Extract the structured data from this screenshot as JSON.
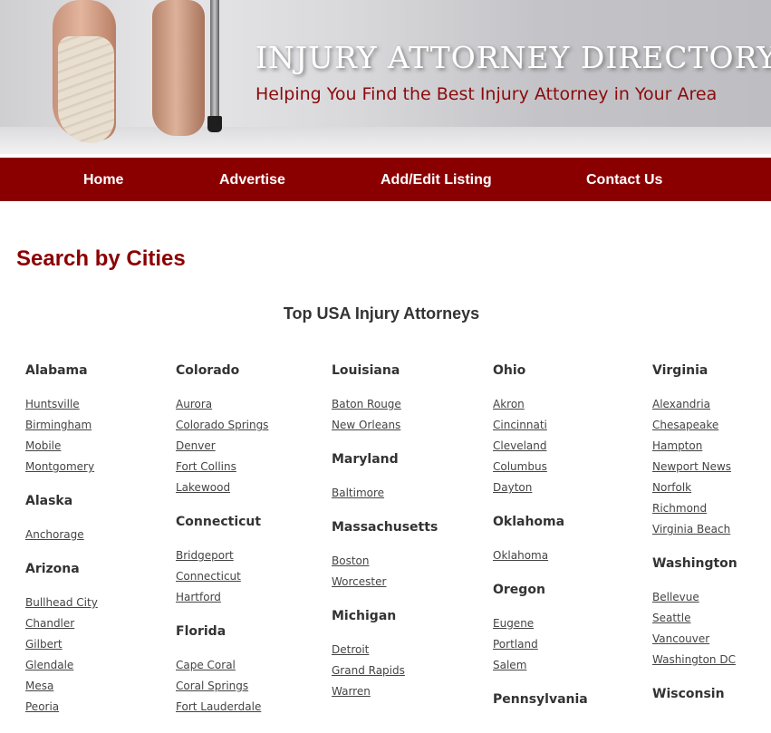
{
  "header": {
    "title": "INJURY ATTORNEY DIRECTORY",
    "tagline": "Helping You Find the Best Injury Attorney in Your Area"
  },
  "nav": {
    "items": [
      "Home",
      "Advertise",
      "Add/Edit Listing",
      "Contact Us"
    ]
  },
  "main": {
    "section_title": "Search by Cities",
    "heading": "Top USA Injury Attorneys"
  },
  "columns": [
    [
      {
        "state": "Alabama",
        "cities": [
          "Huntsville",
          "Birmingham",
          "Mobile",
          "Montgomery"
        ]
      },
      {
        "state": "Alaska",
        "cities": [
          "Anchorage"
        ]
      },
      {
        "state": "Arizona",
        "cities": [
          "Bullhead City",
          "Chandler",
          "Gilbert",
          "Glendale",
          "Mesa",
          "Peoria"
        ]
      }
    ],
    [
      {
        "state": "Colorado",
        "cities": [
          "Aurora",
          "Colorado Springs",
          "Denver",
          "Fort Collins",
          "Lakewood"
        ]
      },
      {
        "state": "Connecticut",
        "cities": [
          "Bridgeport",
          "Connecticut",
          "Hartford"
        ]
      },
      {
        "state": "Florida",
        "cities": [
          "Cape Coral",
          "Coral Springs",
          "Fort Lauderdale"
        ]
      }
    ],
    [
      {
        "state": "Louisiana",
        "cities": [
          "Baton Rouge",
          "New Orleans"
        ]
      },
      {
        "state": "Maryland",
        "cities": [
          "Baltimore"
        ]
      },
      {
        "state": "Massachusetts",
        "cities": [
          "Boston",
          "Worcester"
        ]
      },
      {
        "state": "Michigan",
        "cities": [
          "Detroit",
          "Grand Rapids",
          "Warren"
        ]
      }
    ],
    [
      {
        "state": "Ohio",
        "cities": [
          "Akron",
          "Cincinnati",
          "Cleveland",
          "Columbus",
          "Dayton"
        ]
      },
      {
        "state": "Oklahoma",
        "cities": [
          "Oklahoma"
        ]
      },
      {
        "state": "Oregon",
        "cities": [
          "Eugene",
          "Portland",
          "Salem"
        ]
      },
      {
        "state": "Pennsylvania",
        "cities": []
      }
    ],
    [
      {
        "state": "Virginia",
        "cities": [
          "Alexandria",
          "Chesapeake",
          "Hampton",
          "Newport News",
          "Norfolk",
          "Richmond",
          "Virginia Beach"
        ]
      },
      {
        "state": "Washington",
        "cities": [
          "Bellevue",
          "Seattle",
          "Vancouver",
          "Washington DC"
        ]
      },
      {
        "state": "Wisconsin",
        "cities": []
      }
    ]
  ],
  "colors": {
    "brand_red": "#8a0000",
    "title_red": "#8b0000",
    "text_dark": "#333333",
    "link": "#444444"
  }
}
